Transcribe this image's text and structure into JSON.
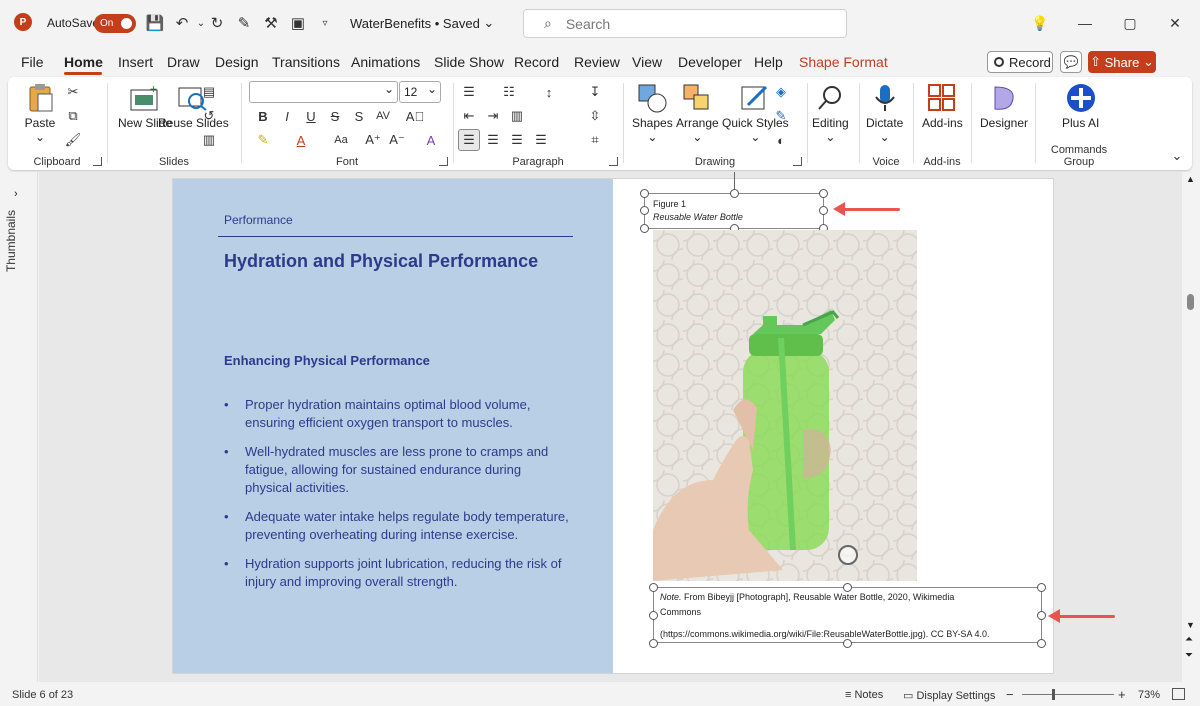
{
  "titlebar": {
    "app_logo": "P",
    "autosave_label": "AutoSave",
    "autosave_state": "On",
    "doc_title": "WaterBenefits • Saved",
    "search_placeholder": "Search"
  },
  "menu": {
    "tabs": [
      "File",
      "Home",
      "Insert",
      "Draw",
      "Design",
      "Transitions",
      "Animations",
      "Slide Show",
      "Record",
      "Review",
      "View",
      "Developer",
      "Help",
      "Shape Format"
    ],
    "active": "Home",
    "record_label": "Record",
    "share_label": "Share"
  },
  "ribbon": {
    "clipboard": {
      "label": "Clipboard",
      "paste": "Paste"
    },
    "slides": {
      "label": "Slides",
      "new_slide": "New Slide",
      "reuse_slides": "Reuse Slides"
    },
    "font": {
      "label": "Font",
      "font_name": "",
      "font_size": "12"
    },
    "paragraph": {
      "label": "Paragraph"
    },
    "drawing": {
      "label": "Drawing",
      "shapes": "Shapes",
      "arrange": "Arrange",
      "quick_styles": "Quick Styles"
    },
    "editing": {
      "label": "Editing"
    },
    "voice": {
      "label": "Voice",
      "dictate": "Dictate"
    },
    "addins": {
      "label": "Add-ins",
      "addins_btn": "Add-ins"
    },
    "designer": {
      "label": "Designer"
    },
    "commands": {
      "label": "Commands Group",
      "plus_ai": "Plus AI"
    }
  },
  "thumbnails_label": "Thumbnails",
  "slide": {
    "section_label": "Performance",
    "title": "Hydration and Physical Performance",
    "sub_heading": "Enhancing Physical Performance",
    "bullets": [
      "Proper hydration maintains optimal blood volume, ensuring efficient oxygen transport to muscles.",
      "Well-hydrated muscles are less prone to cramps and fatigue, allowing for sustained endurance during physical activities.",
      "Adequate water intake helps regulate body temperature, preventing overheating during intense exercise.",
      "Hydration supports joint lubrication, reducing the risk of injury and improving overall strength."
    ],
    "figure_number": "Figure 1",
    "figure_caption": "Reusable Water Bottle",
    "note_label": "Note.",
    "note_line1": "From Bibeyjj [Photograph], Reusable Water Bottle, 2020, Wikimedia",
    "note_line2": "Commons",
    "note_line3": "(https://commons.wikimedia.org/wiki/File:ReusableWaterBottle.jpg). CC BY-SA 4.0."
  },
  "statusbar": {
    "slide_count": "Slide 6 of 23",
    "notes": "Notes",
    "display_settings": "Display Settings",
    "zoom": "73%"
  },
  "colors": {
    "accent": "#c43e1c",
    "slide_panel": "#b9cfe6",
    "slide_text": "#2d3a8c",
    "callout_arrow": "#e8554e"
  }
}
